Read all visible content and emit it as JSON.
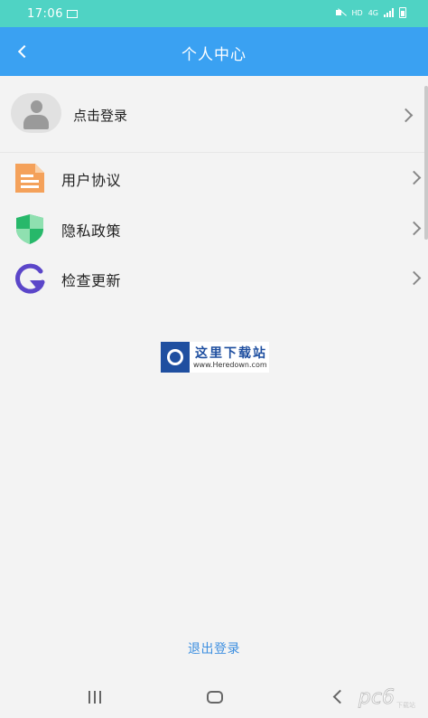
{
  "status_bar": {
    "time": "17:06",
    "hd_label": "HD",
    "network_label": "4G"
  },
  "header": {
    "title": "个人中心"
  },
  "login": {
    "label": "点击登录"
  },
  "menu": {
    "items": [
      {
        "label": "用户协议",
        "icon": "document-icon",
        "color": "#f4a15a"
      },
      {
        "label": "隐私政策",
        "icon": "shield-icon",
        "color": "#27b86a"
      },
      {
        "label": "检查更新",
        "icon": "refresh-icon",
        "color": "#5b46c9"
      }
    ]
  },
  "watermark": {
    "title": "这里下载站",
    "url": "www.Heredown.com"
  },
  "footer": {
    "logout_label": "退出登录"
  },
  "corner_logo": {
    "text": "pc6",
    "subtext": "下载站"
  },
  "colors": {
    "status_bar": "#4fd3c4",
    "nav_bar": "#3aa1f2",
    "background": "#f3f3f3",
    "link": "#3d8fe0"
  }
}
